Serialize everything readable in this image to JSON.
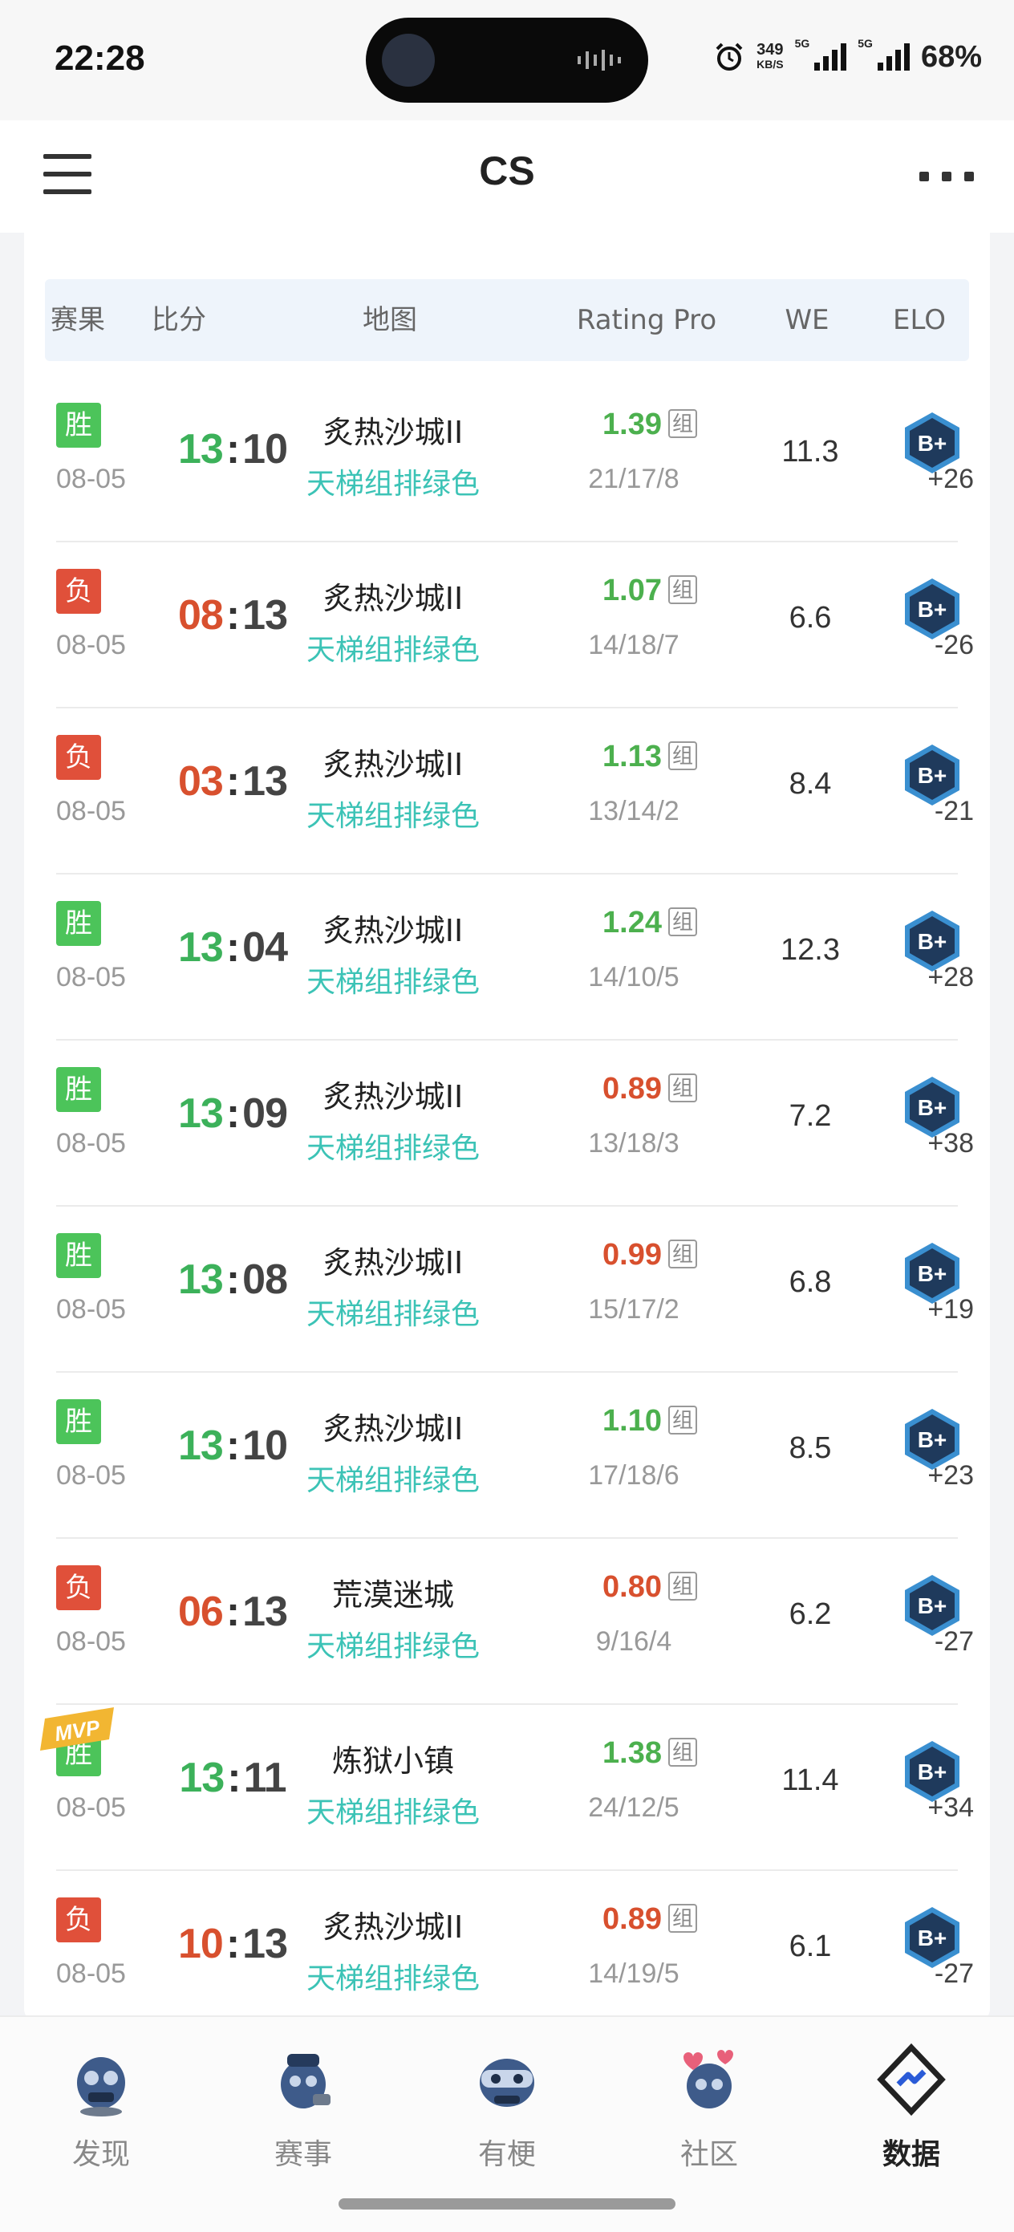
{
  "status": {
    "time": "22:28",
    "speed_value": "349",
    "speed_unit": "KB/S",
    "net1": "5G",
    "net2": "5G",
    "battery": "68%"
  },
  "header": {
    "title": "CS"
  },
  "table": {
    "headers": [
      "赛果",
      "比分",
      "地图",
      "Rating Pro",
      "WE",
      "ELO"
    ],
    "tag_label": "组",
    "mvp_label": "MVP",
    "rows": [
      {
        "result": "胜",
        "win": true,
        "date": "08-05",
        "s1": "13",
        "s2": "10",
        "map": "炙热沙城II",
        "mode": "天梯组排绿色",
        "rating": "1.39",
        "rating_good": true,
        "kda": "21/17/8",
        "we": "11.3",
        "elo": "+26",
        "mvp": false
      },
      {
        "result": "负",
        "win": false,
        "date": "08-05",
        "s1": "08",
        "s2": "13",
        "map": "炙热沙城II",
        "mode": "天梯组排绿色",
        "rating": "1.07",
        "rating_good": true,
        "kda": "14/18/7",
        "we": "6.6",
        "elo": "-26",
        "mvp": false
      },
      {
        "result": "负",
        "win": false,
        "date": "08-05",
        "s1": "03",
        "s2": "13",
        "map": "炙热沙城II",
        "mode": "天梯组排绿色",
        "rating": "1.13",
        "rating_good": true,
        "kda": "13/14/2",
        "we": "8.4",
        "elo": "-21",
        "mvp": false
      },
      {
        "result": "胜",
        "win": true,
        "date": "08-05",
        "s1": "13",
        "s2": "04",
        "map": "炙热沙城II",
        "mode": "天梯组排绿色",
        "rating": "1.24",
        "rating_good": true,
        "kda": "14/10/5",
        "we": "12.3",
        "elo": "+28",
        "mvp": false
      },
      {
        "result": "胜",
        "win": true,
        "date": "08-05",
        "s1": "13",
        "s2": "09",
        "map": "炙热沙城II",
        "mode": "天梯组排绿色",
        "rating": "0.89",
        "rating_good": false,
        "kda": "13/18/3",
        "we": "7.2",
        "elo": "+38",
        "mvp": false
      },
      {
        "result": "胜",
        "win": true,
        "date": "08-05",
        "s1": "13",
        "s2": "08",
        "map": "炙热沙城II",
        "mode": "天梯组排绿色",
        "rating": "0.99",
        "rating_good": false,
        "kda": "15/17/2",
        "we": "6.8",
        "elo": "+19",
        "mvp": false
      },
      {
        "result": "胜",
        "win": true,
        "date": "08-05",
        "s1": "13",
        "s2": "10",
        "map": "炙热沙城II",
        "mode": "天梯组排绿色",
        "rating": "1.10",
        "rating_good": true,
        "kda": "17/18/6",
        "we": "8.5",
        "elo": "+23",
        "mvp": false
      },
      {
        "result": "负",
        "win": false,
        "date": "08-05",
        "s1": "06",
        "s2": "13",
        "map": "荒漠迷城",
        "mode": "天梯组排绿色",
        "rating": "0.80",
        "rating_good": false,
        "kda": "9/16/4",
        "we": "6.2",
        "elo": "-27",
        "mvp": false
      },
      {
        "result": "胜",
        "win": true,
        "date": "08-05",
        "s1": "13",
        "s2": "11",
        "map": "炼狱小镇",
        "mode": "天梯组排绿色",
        "rating": "1.38",
        "rating_good": true,
        "kda": "24/12/5",
        "we": "11.4",
        "elo": "+34",
        "mvp": true
      },
      {
        "result": "负",
        "win": false,
        "date": "08-05",
        "s1": "10",
        "s2": "13",
        "map": "炙热沙城II",
        "mode": "天梯组排绿色",
        "rating": "0.89",
        "rating_good": false,
        "kda": "14/19/5",
        "we": "6.1",
        "elo": "-27",
        "mvp": false
      }
    ]
  },
  "colors": {
    "win": "#4cc45a",
    "lose": "#e0503a",
    "mode": "#3cc3b6",
    "elo_badge": "#1f3a5c"
  },
  "nav": {
    "items": [
      {
        "label": "发现",
        "icon": "discover-mascot-icon"
      },
      {
        "label": "赛事",
        "icon": "events-mascot-icon"
      },
      {
        "label": "有梗",
        "icon": "meme-mascot-icon"
      },
      {
        "label": "社区",
        "icon": "community-mascot-icon"
      },
      {
        "label": "数据",
        "icon": "data-diamond-icon",
        "active": true
      }
    ]
  }
}
